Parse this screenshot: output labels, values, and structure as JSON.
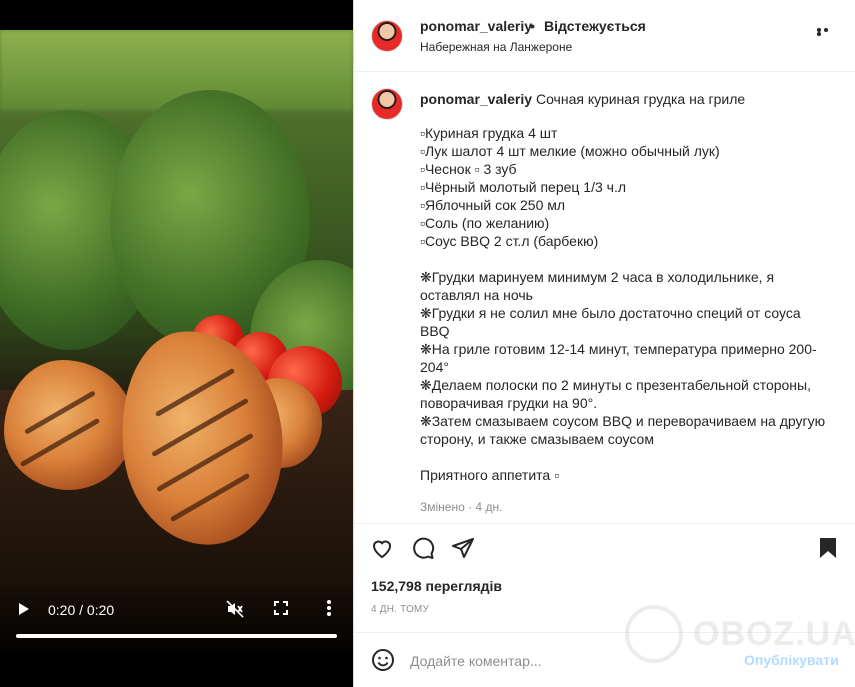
{
  "video": {
    "time_display": "0:20 / 0:20",
    "progress": 1.0,
    "icons": [
      "play-icon",
      "muted-icon",
      "fullscreen-icon",
      "more-vertical-icon"
    ]
  },
  "header": {
    "username": "ponomar_valeriy",
    "separator": "•",
    "follow_label": "Відстежується",
    "location": "Набережная на Ланжероне"
  },
  "caption": {
    "username": "ponomar_valeriy",
    "title": "Сочная куриная грудка на гриле",
    "body": "▫Куриная грудка 4 шт\n▫Лук шалот 4 шт мелкие (можно обычный лук)\n▫Чеснок ▫ 3 зуб\n▫Чёрный молотый перец 1/3 ч.л\n▫Яблочный сок 250 мл\n▫Соль (по желанию)\n▫Соус BBQ 2 ст.л (барбекю)\n\n❋Грудки маринуем минимум 2 часа в холодильнике, я оставлял на ночь\n❋Грудки я не солил мне было достаточно специй от соуса BBQ\n❋На гриле готовим 12-14 минут, температура примерно 200-204°\n❋Делаем полоски по 2 минуты с презентабельной стороны, поворачивая грудки на 90°.\n❋Затем смазываем соусом BBQ и переворачиваем на другую сторону, и также смазываем соусом\n\nПриятного аппетита ▫",
    "meta": "Змінено · 4 дн."
  },
  "actions": {
    "views": "152,798 переглядів",
    "ago": "4 ДН. ТОМУ"
  },
  "comment_bar": {
    "placeholder": "Додайте коментар...",
    "publish_label": "Опублікувати"
  },
  "watermark": {
    "text": "OBOZ.UA"
  },
  "colors": {
    "accent": "#0095f6",
    "publish_disabled": "#b3dbff",
    "muted_text": "#8e8e8e",
    "border": "#dbdbdb"
  }
}
